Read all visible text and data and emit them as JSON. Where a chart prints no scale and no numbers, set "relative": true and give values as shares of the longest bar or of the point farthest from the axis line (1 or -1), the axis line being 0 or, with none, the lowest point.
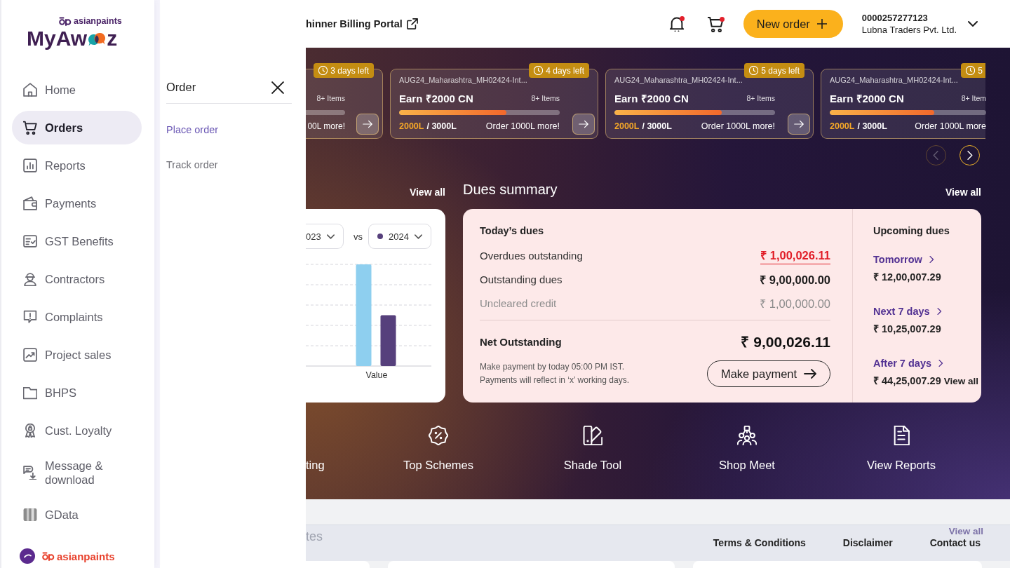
{
  "sidebar": {
    "logo": {
      "brand": "asianpaints",
      "name_start": "MyAw",
      "name_end": "z"
    },
    "items": [
      {
        "label": "Home",
        "selected": false
      },
      {
        "label": "Orders",
        "selected": true
      },
      {
        "label": "Reports",
        "selected": false
      },
      {
        "label": "Payments",
        "selected": false
      },
      {
        "label": "GST Benefits",
        "selected": false
      },
      {
        "label": "Contractors",
        "selected": false
      },
      {
        "label": "Complaints",
        "selected": false
      },
      {
        "label": "Project sales",
        "selected": false
      },
      {
        "label": "BHPS",
        "selected": false
      },
      {
        "label": "Cust. Loyalty",
        "selected": false
      },
      {
        "label": "Message & download",
        "selected": false
      },
      {
        "label": "GData",
        "selected": false
      }
    ],
    "footer_brand": "asianpaints"
  },
  "submenu": {
    "title": "Order",
    "items": [
      {
        "label": "Place order",
        "selected": true
      },
      {
        "label": "Track order",
        "selected": false
      }
    ]
  },
  "header": {
    "portal_link": "hinner Billing Portal",
    "notifications_unread": true,
    "cart_unread": true,
    "new_order_button": "New order",
    "account_number": "0000257277123",
    "account_name": "Lubna Traders Pvt. Ltd."
  },
  "carousel": {
    "cards": [
      {
        "kind": "cut_left",
        "badge": "3 days left",
        "items": "8+ Items",
        "more": "00L more!"
      },
      {
        "kind": "whole",
        "badge": "4 days left",
        "title": "AUG24_Maharashtra_MH02424-Int...",
        "earn": "Earn ₹2000 CN",
        "items": "8+ Items",
        "level": 0.67,
        "achieved": "2000L",
        "target": "/ 3000L",
        "more": "Order 1000L more!"
      },
      {
        "kind": "whole",
        "badge": "5 days left",
        "title": "AUG24_Maharashtra_MH02424-Int...",
        "earn": "Earn ₹2000 CN",
        "items": "8+ Items",
        "level": 0.67,
        "achieved": "2000L",
        "target": "/ 3000L",
        "more": "Order 1000L more!"
      },
      {
        "kind": "cut_right",
        "badge": "5",
        "title": "AUG24_Maharashtra_MH02424-Int...",
        "earn": "Earn ₹2000 CN",
        "items": "8+ Item",
        "level": 0.67,
        "achieved": "2000L",
        "target": "/ 3000L",
        "more": "Order 1000L more"
      }
    ],
    "previous_disabled": true,
    "next_disabled": false
  },
  "chart_section": {
    "view_all": "View all",
    "selectors": [
      {
        "kind": "cut",
        "value": "023"
      },
      {
        "kind": "whole",
        "value": "2024",
        "color": "#56407c"
      }
    ],
    "vs_label": "vs",
    "chart_data": {
      "type": "bar",
      "relative": true,
      "categories": [
        "Value"
      ],
      "series": [
        {
          "color": "#8ecfef",
          "values": [
            1
          ]
        },
        {
          "color": "#56407c",
          "values": [
            0.5
          ]
        }
      ]
    }
  },
  "dues_summary": {
    "title": "Dues summary",
    "view_all": "View all",
    "today": {
      "title": "Today’s dues",
      "rows": [
        {
          "kind": "alert",
          "label": "Overdues outstanding",
          "amount": "₹ 1,00,026.11"
        },
        {
          "kind": "normal",
          "label": "Outstanding dues",
          "amount": "₹ 9,00,000.00"
        },
        {
          "kind": "muted",
          "label": "Uncleared credit",
          "amount": "₹ 1,00,000.00"
        }
      ],
      "net_label": "Net Outstanding",
      "net_amount": "₹ 9,00,026.11",
      "note": [
        "Make payment by today 05:00 PM IST.",
        "Payments will reflect in ‘x’ working days."
      ],
      "pay_button": "Make payment"
    },
    "upcoming": {
      "title": "Upcoming dues",
      "items": [
        {
          "label": "Tomorrow",
          "amount": "₹ 12,00,007.29"
        },
        {
          "label": "Next 7 days",
          "amount": "₹ 10,25,007.29"
        },
        {
          "label": "After 7 days",
          "amount": "₹ 44,25,007.29"
        }
      ],
      "view_all": "View all"
    }
  },
  "quick_actions": [
    {
      "kind": "cut",
      "label": "ting"
    },
    {
      "kind": "whole",
      "label": "Top Schemes"
    },
    {
      "kind": "whole",
      "label": "Shade Tool"
    },
    {
      "kind": "whole",
      "label": "Shop Meet"
    },
    {
      "kind": "whole",
      "label": "View Reports"
    }
  ],
  "footer": {
    "section_title": "tes",
    "links": [
      "Terms & Conditions",
      "Disclaimer",
      "Contact us"
    ],
    "view_all": "View all"
  }
}
